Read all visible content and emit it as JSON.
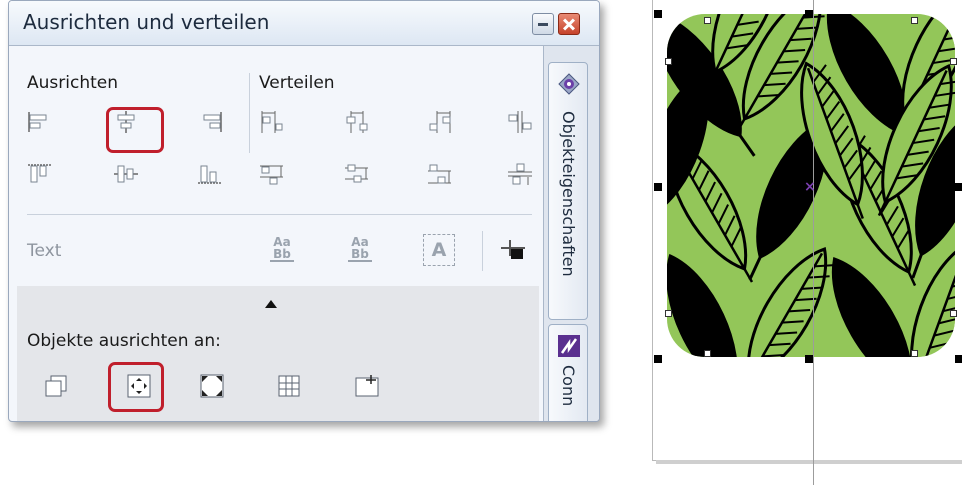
{
  "window": {
    "title": "Ausrichten und verteilen"
  },
  "align": {
    "section_label": "Ausrichten",
    "buttons_row1": [
      "align-left",
      "align-center-horizontal",
      "align-right"
    ],
    "buttons_row2": [
      "align-top",
      "align-center-vertical",
      "align-bottom"
    ],
    "highlighted": "align-center-horizontal"
  },
  "distribute": {
    "section_label": "Verteilen"
  },
  "text": {
    "label": "Text",
    "aa_top": "Aa",
    "aa_bottom": "Bb",
    "a_glyph": "A"
  },
  "align_to": {
    "label": "Objekte ausrichten an:",
    "options": [
      "active-objects",
      "page-center",
      "page-edge",
      "grid",
      "specified-point"
    ],
    "highlighted": "page-center"
  },
  "tabs": [
    {
      "label": "Objekteigenschaften",
      "icon": "object-properties-icon"
    },
    {
      "label": "Conn",
      "icon": "connect-icon"
    }
  ],
  "colors": {
    "highlight": "#c01f2c",
    "leaf_background": "#93c659",
    "leaf_fill": "#000000",
    "center_marker": "#7b3fb0"
  }
}
